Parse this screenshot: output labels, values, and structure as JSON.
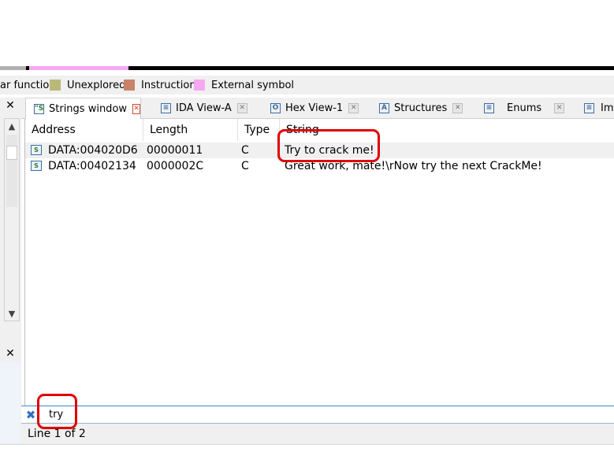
{
  "legend": {
    "items": [
      {
        "label": "ar function",
        "color": ""
      },
      {
        "label": "Unexplored",
        "color": "#b9b97a"
      },
      {
        "label": "Instruction",
        "color": "#c8836a"
      },
      {
        "label": "External symbol",
        "color": "#f5a9f2"
      }
    ]
  },
  "left_panel": {
    "close_glyph_top": "✕",
    "close_glyph_bottom": "✕",
    "scroll_up": "▲",
    "scroll_down": "▼"
  },
  "tabs": [
    {
      "label": "Strings window",
      "icon": "strings-icon",
      "active": true
    },
    {
      "label": "IDA View-A",
      "icon": "ida-view-icon",
      "active": false
    },
    {
      "label": "Hex View-1",
      "icon": "hex-view-icon",
      "active": false
    },
    {
      "label": "Structures",
      "icon": "structures-icon",
      "active": false
    },
    {
      "label": "Enums",
      "icon": "enums-icon",
      "active": false
    },
    {
      "label": "Im",
      "icon": "imports-icon",
      "active": false
    }
  ],
  "table": {
    "columns": [
      "Address",
      "Length",
      "Type",
      "String"
    ],
    "rows": [
      {
        "address": "DATA:004020D6",
        "length": "00000011",
        "type": "C",
        "string": "Try to crack me!"
      },
      {
        "address": "DATA:00402134",
        "length": "0000002C",
        "type": "C",
        "string": "Great work, mate!\\rNow try the next CrackMe!"
      }
    ]
  },
  "filter": {
    "value": "try",
    "clear_glyph": "✖"
  },
  "status": {
    "text": "Line 1 of 2"
  },
  "colors": {
    "accent": "#3e86c4",
    "annotation": "#e00000",
    "nav_external": "#f5a9f2"
  }
}
